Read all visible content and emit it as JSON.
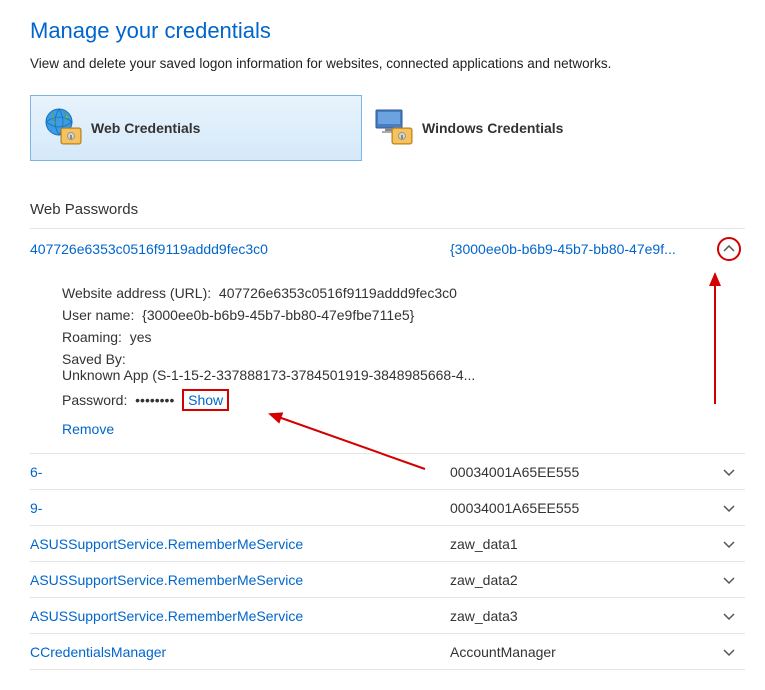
{
  "header": {
    "title": "Manage your credentials",
    "subtitle": "View and delete your saved logon information for websites, connected applications and networks."
  },
  "tabs": {
    "web": "Web Credentials",
    "windows": "Windows Credentials"
  },
  "section_heading": "Web Passwords",
  "expanded": {
    "name": "407726e6353c0516f9119addd9fec3c0",
    "guid": "{3000ee0b-b6b9-45b7-bb80-47e9f...",
    "url_label": "Website address (URL):",
    "url_value": "407726e6353c0516f9119addd9fec3c0",
    "user_label": "User name:",
    "user_value": "{3000ee0b-b6b9-45b7-bb80-47e9fbe711e5}",
    "roaming_label": "Roaming:",
    "roaming_value": "yes",
    "savedby_label": "Saved By:",
    "savedby_value": "Unknown App (S-1-15-2-337888173-3784501919-3848985668-4...",
    "password_label": "Password:",
    "password_value": "••••••••",
    "show_label": "Show",
    "remove_label": "Remove"
  },
  "rows": [
    {
      "left": "6-",
      "right": "00034001A65EE555"
    },
    {
      "left": "9-",
      "right": "00034001A65EE555"
    },
    {
      "left": "ASUSSupportService.RememberMeService",
      "right": "zaw_data1"
    },
    {
      "left": "ASUSSupportService.RememberMeService",
      "right": "zaw_data2"
    },
    {
      "left": "ASUSSupportService.RememberMeService",
      "right": "zaw_data3"
    },
    {
      "left": "CCredentialsManager",
      "right": "AccountManager"
    }
  ]
}
